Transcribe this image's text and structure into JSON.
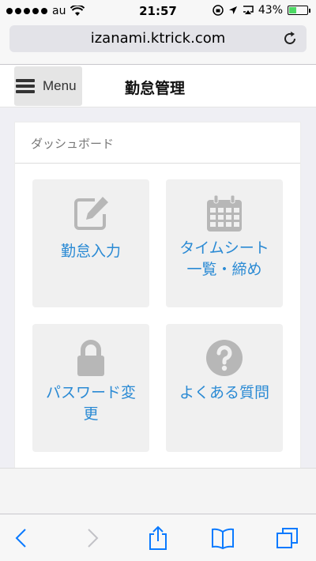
{
  "status_bar": {
    "carrier": "au",
    "time": "21:57",
    "battery": "43%",
    "battery_level": 0.43
  },
  "browser": {
    "url": "izanami.ktrick.com"
  },
  "navbar": {
    "menu_label": "Menu",
    "title": "勤怠管理"
  },
  "dashboard": {
    "heading": "ダッシュボード",
    "tiles": [
      {
        "line1": "勤怠入力",
        "line2": "",
        "icon": "edit-icon"
      },
      {
        "line1": "タイムシート",
        "line2": "一覧・締め",
        "icon": "calendar-icon"
      },
      {
        "line1": "パスワード変",
        "line2": "更",
        "icon": "lock-icon"
      },
      {
        "line1": "よくある質問",
        "line2": "",
        "icon": "question-icon"
      }
    ]
  },
  "toolbar": {
    "icons": [
      "back-icon",
      "forward-icon",
      "share-icon",
      "bookmarks-icon",
      "tabs-icon"
    ]
  },
  "colors": {
    "accent": "#2a8ad4",
    "tile_bg": "#f0f0f0",
    "icon_gray": "#b7b7b7",
    "ios_blue": "#0a7aff"
  }
}
